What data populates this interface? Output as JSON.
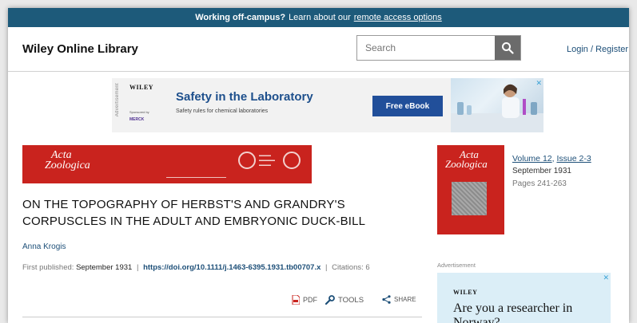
{
  "topbar": {
    "bold": "Working off-campus?",
    "text": "Learn about our",
    "link": "remote access options"
  },
  "header": {
    "logo": "Wiley Online Library",
    "search_placeholder": "Search",
    "login": "Login / Register"
  },
  "ad_banner": {
    "vertical_label": "Advertisement",
    "brand": "WILEY",
    "sponsored": "Sponsored by",
    "sponsor": "MERCK",
    "headline": "Safety in the Laboratory",
    "subline": "Safety rules for chemical laboratories",
    "cta": "Free eBook",
    "close": "✕"
  },
  "journal_banner": {
    "title_line1": "Acta",
    "title_line2": "Zoologica"
  },
  "article": {
    "title_line1": "ON THE TOPOGRAPHY OF HERBST'S AND GRANDRY'S",
    "title_line2": "CORPUSCLES IN THE ADULT AND EMBRYONIC DUCK-BILL",
    "author": "Anna Krogis",
    "first_published_label": "First published:",
    "first_published": "September 1931",
    "sep": "|",
    "doi": "https://doi.org/10.1111/j.1463-6395.1931.tb00707.x",
    "citations": "Citations: 6"
  },
  "tools": {
    "pdf": "PDF",
    "tools": "TOOLS",
    "share": "SHARE"
  },
  "issue": {
    "cover_line1": "Acta",
    "cover_line2": "Zoologica",
    "volume": "Volume 12",
    "comma": ",",
    "issue": "Issue 2-3",
    "date": "September 1931",
    "pages": "Pages 241-263"
  },
  "side_ad": {
    "label": "Advertisement",
    "brand": "WILEY",
    "headline": "Are you a researcher in Norway?",
    "close": "✕"
  },
  "colors": {
    "topbar": "#1d5a7a",
    "link": "#1d4f78",
    "journal_red": "#c9231e",
    "cta": "#214f9a"
  }
}
